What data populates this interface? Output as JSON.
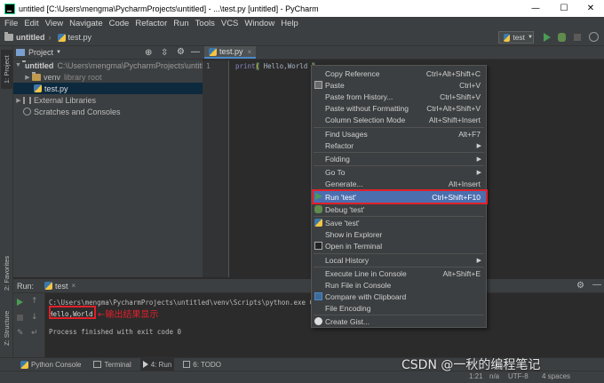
{
  "window": {
    "title": "untitled [C:\\Users\\mengma\\PycharmProjects\\untitled] - ...\\test.py [untitled] - PyCharm",
    "minimize": "—",
    "maximize": "☐",
    "close": "✕"
  },
  "menu": [
    "File",
    "Edit",
    "View",
    "Navigate",
    "Code",
    "Refactor",
    "Run",
    "Tools",
    "VCS",
    "Window",
    "Help"
  ],
  "breadcrumb": {
    "project": "untitled",
    "file": "test.py"
  },
  "run_config": "test",
  "left_tabs": {
    "project": "1: Project",
    "favorites": "2: Favorites",
    "structure": "Z: Structure"
  },
  "project_panel": {
    "title": "Project",
    "tree": [
      {
        "label": "untitled",
        "path": "C:\\Users\\mengma\\PycharmProjects\\untitled",
        "expanded": true
      },
      {
        "label": "venv",
        "note": "library root"
      },
      {
        "label": "test.py"
      },
      {
        "label": "External Libraries"
      },
      {
        "label": "Scratches and Consoles"
      }
    ]
  },
  "editor": {
    "tab": "test.py",
    "line_number": "1",
    "code": {
      "kw": "print",
      "open": "(",
      "arg": " Hello,World ",
      "close": ")"
    }
  },
  "run_panel": {
    "label": "Run:",
    "tab": "test",
    "command": "C:\\Users\\mengma\\PycharmProjects\\untitled\\venv\\Scripts\\python.exe C:\\Users",
    "output": "Hello,World",
    "annotation": "←输出结果显示",
    "exit": "Process finished with exit code 0"
  },
  "bottom_tabs": [
    "Python Console",
    "Terminal",
    "4: Run",
    "6: TODO"
  ],
  "status": {
    "position": "1:21",
    "line_sep": "n/a",
    "encoding": "UTF-8",
    "indent": "4 spaces"
  },
  "watermark": "CSDN @一秋的编程笔记",
  "context_menu": [
    {
      "label": "Copy Reference",
      "shortcut": "Ctrl+Alt+Shift+C"
    },
    {
      "label": "Paste",
      "shortcut": "Ctrl+V",
      "icon": "paste-icon"
    },
    {
      "label": "Paste from History...",
      "shortcut": "Ctrl+Shift+V"
    },
    {
      "label": "Paste without Formatting",
      "shortcut": "Ctrl+Alt+Shift+V"
    },
    {
      "label": "Column Selection Mode",
      "shortcut": "Alt+Shift+Insert"
    },
    {
      "label": "Find Usages",
      "shortcut": "Alt+F7"
    },
    {
      "label": "Refactor",
      "submenu": true
    },
    {
      "label": "Folding",
      "submenu": true
    },
    {
      "label": "Go To",
      "submenu": true
    },
    {
      "label": "Generate...",
      "shortcut": "Alt+Insert"
    },
    {
      "label": "Run 'test'",
      "shortcut": "Ctrl+Shift+F10",
      "icon": "run-icon",
      "highlighted": true
    },
    {
      "label": "Debug 'test'",
      "icon": "debug-icon"
    },
    {
      "label": "Save 'test'",
      "icon": "python-icon"
    },
    {
      "label": "Show in Explorer"
    },
    {
      "label": "Open in Terminal",
      "icon": "terminal-icon"
    },
    {
      "label": "Local History",
      "submenu": true
    },
    {
      "label": "Execute Line in Console",
      "shortcut": "Alt+Shift+E"
    },
    {
      "label": "Run File in Console"
    },
    {
      "label": "Compare with Clipboard",
      "icon": "compare-icon"
    },
    {
      "label": "File Encoding"
    },
    {
      "label": "Create Gist...",
      "icon": "github-icon"
    }
  ],
  "colors": {
    "highlight": "#4b6eaf",
    "annotation_red": "#e0202a",
    "run_green": "#499c54",
    "ide_bg": "#2b2b2b",
    "panel": "#3c3f41"
  }
}
